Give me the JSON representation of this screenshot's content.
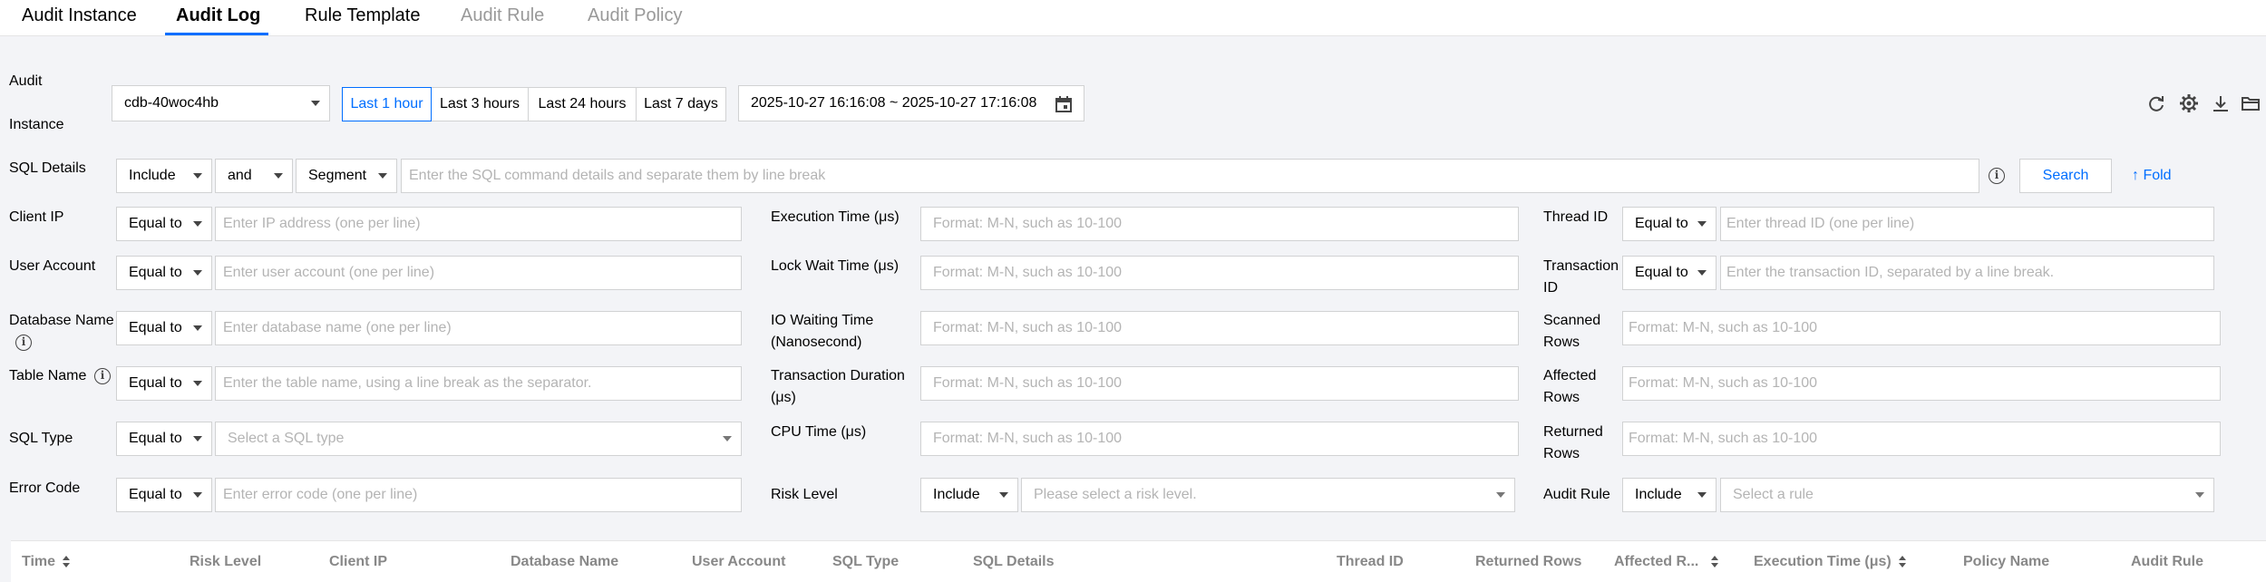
{
  "tabs": [
    {
      "label": "Audit Instance"
    },
    {
      "label": "Audit Log"
    },
    {
      "label": "Rule Template"
    },
    {
      "label": "Audit Rule"
    },
    {
      "label": "Audit Policy"
    }
  ],
  "audit_instance": {
    "label_line1": "Audit",
    "label_line2": "Instance",
    "value": "cdb-40woc4hb"
  },
  "time_presets": [
    "Last 1 hour",
    "Last 3 hours",
    "Last 24 hours",
    "Last 7 days"
  ],
  "time_range": "2025-10-27 16:16:08 ~ 2025-10-27 17:16:08",
  "sql_details": {
    "label": "SQL Details",
    "mode": "Include",
    "logic": "and",
    "match": "Segment",
    "placeholder": "Enter the SQL command details and separate them by line break"
  },
  "search_label": "Search",
  "fold_label": "Fold",
  "fold_arrow": "↑",
  "info_glyph": "i",
  "filters": {
    "client_ip": {
      "label": "Client IP",
      "op": "Equal to",
      "placeholder": "Enter IP address (one per line)"
    },
    "user_account": {
      "label": "User Account",
      "op": "Equal to",
      "placeholder": "Enter user account (one per line)"
    },
    "database_name": {
      "label": "Database Name",
      "op": "Equal to",
      "placeholder": "Enter database name (one per line)"
    },
    "table_name": {
      "label": "Table Name",
      "op": "Equal to",
      "placeholder": "Enter the table name, using a line break as the separator."
    },
    "sql_type": {
      "label": "SQL Type",
      "op": "Equal to",
      "placeholder": "Select a SQL type"
    },
    "error_code": {
      "label": "Error Code",
      "op": "Equal to",
      "placeholder": "Enter error code (one per line)"
    },
    "execution_time": {
      "label": "Execution Time (μs)",
      "placeholder": "Format: M-N, such as 10-100"
    },
    "lock_wait_time": {
      "label": "Lock Wait Time (μs)",
      "placeholder": "Format: M-N, such as 10-100"
    },
    "io_waiting_time": {
      "label_line1": "IO Waiting Time",
      "label_line2": "(Nanosecond)",
      "placeholder": "Format: M-N, such as 10-100"
    },
    "transaction_duration": {
      "label_line1": "Transaction Duration",
      "label_line2": "(μs)",
      "placeholder": "Format: M-N, such as 10-100"
    },
    "cpu_time": {
      "label": "CPU Time (μs)",
      "placeholder": "Format: M-N, such as 10-100"
    },
    "risk_level": {
      "label": "Risk Level",
      "op": "Include",
      "placeholder": "Please select a risk level."
    },
    "thread_id": {
      "label": "Thread ID",
      "op": "Equal to",
      "placeholder": "Enter thread ID (one per line)"
    },
    "transaction_id": {
      "label_line1": "Transaction",
      "label_line2": "ID",
      "op": "Equal to",
      "placeholder": "Enter the transaction ID, separated by a line break."
    },
    "scanned_rows": {
      "label_line1": "Scanned",
      "label_line2": "Rows",
      "placeholder": "Format: M-N, such as 10-100"
    },
    "affected_rows": {
      "label_line1": "Affected",
      "label_line2": "Rows",
      "placeholder": "Format: M-N, such as 10-100"
    },
    "returned_rows": {
      "label_line1": "Returned",
      "label_line2": "Rows",
      "placeholder": "Format: M-N, such as 10-100"
    },
    "audit_rule": {
      "label": "Audit Rule",
      "op": "Include",
      "placeholder": "Select a rule"
    }
  },
  "table": {
    "columns": [
      "Time",
      "Risk Level",
      "Client IP",
      "Database Name",
      "User Account",
      "SQL Type",
      "SQL Details",
      "Thread ID",
      "Returned Rows",
      "Affected R...",
      "Execution Time (μs)",
      "Policy Name",
      "Audit Rule"
    ]
  },
  "colors": {
    "accent": "#006eff",
    "placeholder": "#b4b4b4",
    "header_text": "#888888"
  }
}
